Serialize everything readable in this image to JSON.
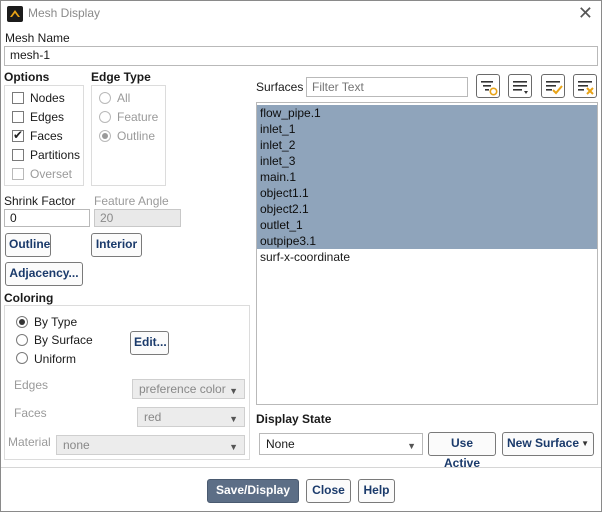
{
  "window": {
    "title": "Mesh Display",
    "close_glyph": "✕"
  },
  "mesh_name": {
    "label": "Mesh Name",
    "value": "mesh-1"
  },
  "options": {
    "label": "Options",
    "items": [
      {
        "label": "Nodes",
        "checked": false,
        "enabled": true
      },
      {
        "label": "Edges",
        "checked": false,
        "enabled": true
      },
      {
        "label": "Faces",
        "checked": true,
        "enabled": true
      },
      {
        "label": "Partitions",
        "checked": false,
        "enabled": true
      },
      {
        "label": "Overset",
        "checked": false,
        "enabled": false
      }
    ]
  },
  "edge_type": {
    "label": "Edge Type",
    "items": [
      {
        "label": "All",
        "selected": false
      },
      {
        "label": "Feature",
        "selected": false
      },
      {
        "label": "Outline",
        "selected": true
      }
    ]
  },
  "shrink_factor": {
    "label": "Shrink Factor",
    "value": "0"
  },
  "feature_angle": {
    "label": "Feature Angle",
    "value": "20"
  },
  "buttons": {
    "outline": "Outline",
    "interior": "Interior",
    "adjacency": "Adjacency...",
    "edit": "Edit...",
    "use_active": "Use Active",
    "new_surface": "New Surface",
    "save_display": "Save/Display",
    "close": "Close",
    "help": "Help"
  },
  "coloring": {
    "label": "Coloring",
    "items": [
      {
        "label": "By Type",
        "selected": true
      },
      {
        "label": "By Surface",
        "selected": false
      },
      {
        "label": "Uniform",
        "selected": false
      }
    ],
    "edges_label": "Edges",
    "edges_value": "preference color",
    "faces_label": "Faces",
    "faces_value": "red",
    "material_label": "Material",
    "material_value": "none"
  },
  "surfaces": {
    "label": "Surfaces",
    "filter_placeholder": "Filter Text",
    "icons": [
      "filter-settings-icon",
      "sort-list-icon",
      "select-all-icon",
      "deselect-all-icon"
    ],
    "items": [
      {
        "name": "flow_pipe.1",
        "selected": true
      },
      {
        "name": "inlet_1",
        "selected": true
      },
      {
        "name": "inlet_2",
        "selected": true
      },
      {
        "name": "inlet_3",
        "selected": true
      },
      {
        "name": "main.1",
        "selected": true
      },
      {
        "name": "object1.1",
        "selected": true
      },
      {
        "name": "object2.1",
        "selected": true
      },
      {
        "name": "outlet_1",
        "selected": true
      },
      {
        "name": "outpipe3.1",
        "selected": true
      },
      {
        "name": "surf-x-coordinate",
        "selected": false
      }
    ]
  },
  "display_state": {
    "label": "Display State",
    "value": "None"
  },
  "colors": {
    "selection": "#8fa4bb",
    "primary_button": "#5c6e86",
    "accent_icon": "#e8a317"
  }
}
